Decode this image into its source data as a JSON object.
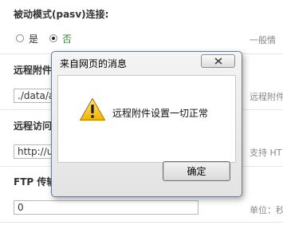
{
  "form": {
    "pasv_label": "被动模式(pasv)连接:",
    "pasv_options": [
      "是",
      "否"
    ],
    "pasv_selected": "否",
    "pasv_hint": "一般情",
    "remote_dir_label": "远程附件",
    "remote_dir_value": "./data/a",
    "remote_dir_hint": "远程附件",
    "remote_url_label": "远程访问",
    "remote_url_value": "http://u",
    "remote_url_hint": "支持 HT",
    "ftp_timeout_label": "FTP 传输",
    "ftp_timeout_value": "0",
    "ftp_timeout_hint": "单位：秒"
  },
  "dialog": {
    "title": "来自网页的消息",
    "message": "远程附件设置一切正常",
    "ok_label": "确定",
    "icon": "warning-icon",
    "close_icon": "close-icon"
  }
}
